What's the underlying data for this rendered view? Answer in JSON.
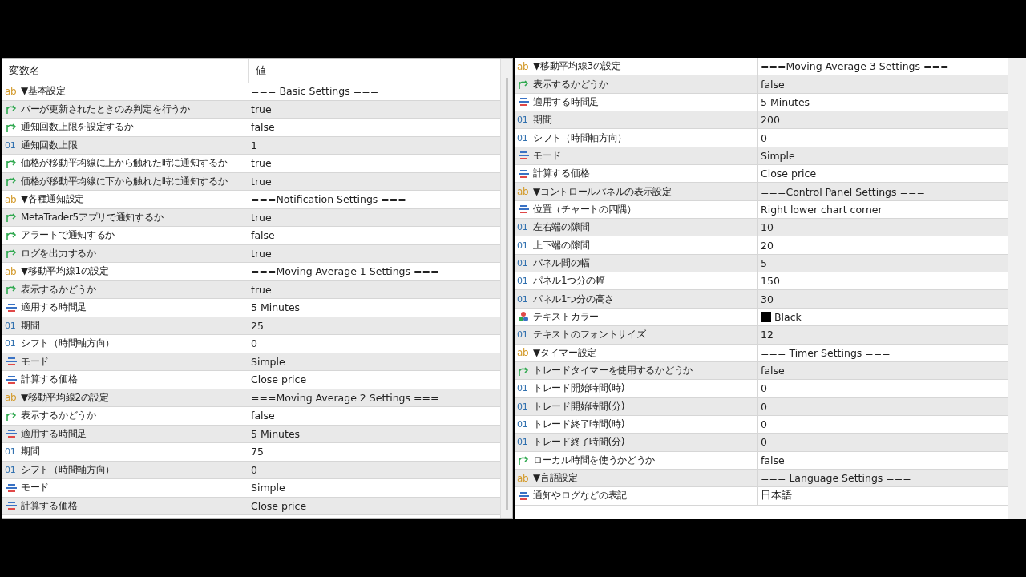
{
  "left_panel": {
    "columns": [
      "変数名",
      "値"
    ],
    "rows": [
      {
        "kind": "group",
        "badge": "ab",
        "name": "▼基本設定",
        "value": "=== Basic Settings ==="
      },
      {
        "kind": "bool",
        "name": "バーが更新されたときのみ判定を行うか",
        "value": "true"
      },
      {
        "kind": "bool",
        "name": "通知回数上限を設定するか",
        "value": "false"
      },
      {
        "kind": "int",
        "badge": "01",
        "name": "通知回数上限",
        "value": "1"
      },
      {
        "kind": "bool",
        "name": "価格が移動平均線に上から触れた時に通知するか",
        "value": "true"
      },
      {
        "kind": "bool",
        "name": "価格が移動平均線に下から触れた時に通知するか",
        "value": "true"
      },
      {
        "kind": "group",
        "badge": "ab",
        "name": "▼各種通知設定",
        "value": "===Notification Settings ==="
      },
      {
        "kind": "bool",
        "name": "MetaTrader5アプリで通知するか",
        "value": "true"
      },
      {
        "kind": "bool",
        "name": "アラートで通知するか",
        "value": "false"
      },
      {
        "kind": "bool",
        "name": "ログを出力するか",
        "value": "true"
      },
      {
        "kind": "group",
        "badge": "ab",
        "name": "▼移動平均線1の設定",
        "value": "===Moving Average 1 Settings ==="
      },
      {
        "kind": "bool",
        "name": "表示するかどうか",
        "value": "true"
      },
      {
        "kind": "enum",
        "name": "適用する時間足",
        "value": "5 Minutes"
      },
      {
        "kind": "int",
        "badge": "01",
        "name": "期間",
        "value": "25"
      },
      {
        "kind": "int",
        "badge": "01",
        "name": "シフト（時間軸方向）",
        "value": "0"
      },
      {
        "kind": "enum",
        "name": "モード",
        "value": "Simple"
      },
      {
        "kind": "enum",
        "name": "計算する価格",
        "value": "Close price"
      },
      {
        "kind": "group",
        "badge": "ab",
        "name": "▼移動平均線2の設定",
        "value": "===Moving Average 2 Settings ==="
      },
      {
        "kind": "bool",
        "name": "表示するかどうか",
        "value": "false"
      },
      {
        "kind": "enum",
        "name": "適用する時間足",
        "value": "5 Minutes"
      },
      {
        "kind": "int",
        "badge": "01",
        "name": "期間",
        "value": "75"
      },
      {
        "kind": "int",
        "badge": "01",
        "name": "シフト（時間軸方向）",
        "value": "0"
      },
      {
        "kind": "enum",
        "name": "モード",
        "value": "Simple"
      },
      {
        "kind": "enum",
        "name": "計算する価格",
        "value": "Close price"
      }
    ]
  },
  "right_panel": {
    "rows": [
      {
        "kind": "group",
        "badge": "ab",
        "name": "▼移動平均線3の設定",
        "value": "===Moving Average 3 Settings ==="
      },
      {
        "kind": "bool",
        "name": "表示するかどうか",
        "value": "false"
      },
      {
        "kind": "enum",
        "name": "適用する時間足",
        "value": "5 Minutes"
      },
      {
        "kind": "int",
        "badge": "01",
        "name": "期間",
        "value": "200"
      },
      {
        "kind": "int",
        "badge": "01",
        "name": "シフト（時間軸方向）",
        "value": "0"
      },
      {
        "kind": "enum",
        "name": "モード",
        "value": "Simple"
      },
      {
        "kind": "enum",
        "name": "計算する価格",
        "value": "Close price"
      },
      {
        "kind": "group",
        "badge": "ab",
        "name": "▼コントロールパネルの表示設定",
        "value": "===Control Panel Settings ==="
      },
      {
        "kind": "enum",
        "name": "位置（チャートの四隅）",
        "value": "Right lower chart corner"
      },
      {
        "kind": "int",
        "badge": "01",
        "name": "左右端の隙間",
        "value": "10"
      },
      {
        "kind": "int",
        "badge": "01",
        "name": "上下端の隙間",
        "value": "20"
      },
      {
        "kind": "int",
        "badge": "01",
        "name": "パネル間の幅",
        "value": "5"
      },
      {
        "kind": "int",
        "badge": "01",
        "name": "パネル1つ分の幅",
        "value": "150"
      },
      {
        "kind": "int",
        "badge": "01",
        "name": "パネル1つ分の高さ",
        "value": "30"
      },
      {
        "kind": "color",
        "name": "テキストカラー",
        "value": "Black",
        "color": "#000000"
      },
      {
        "kind": "int",
        "badge": "01",
        "name": "テキストのフォントサイズ",
        "value": "12"
      },
      {
        "kind": "group",
        "badge": "ab",
        "name": "▼タイマー設定",
        "value": "=== Timer Settings ==="
      },
      {
        "kind": "bool",
        "name": "トレードタイマーを使用するかどうか",
        "value": "false"
      },
      {
        "kind": "int",
        "badge": "01",
        "name": "トレード開始時間(時)",
        "value": "0"
      },
      {
        "kind": "int",
        "badge": "01",
        "name": "トレード開始時間(分)",
        "value": "0"
      },
      {
        "kind": "int",
        "badge": "01",
        "name": "トレード終了時間(時)",
        "value": "0"
      },
      {
        "kind": "int",
        "badge": "01",
        "name": "トレード終了時間(分)",
        "value": "0"
      },
      {
        "kind": "bool",
        "name": "ローカル時間を使うかどうか",
        "value": "false"
      },
      {
        "kind": "group",
        "badge": "ab",
        "name": "▼言語設定",
        "value": "=== Language Settings ==="
      },
      {
        "kind": "enum",
        "name": "通知やログなどの表記",
        "value": "日本語"
      }
    ]
  }
}
